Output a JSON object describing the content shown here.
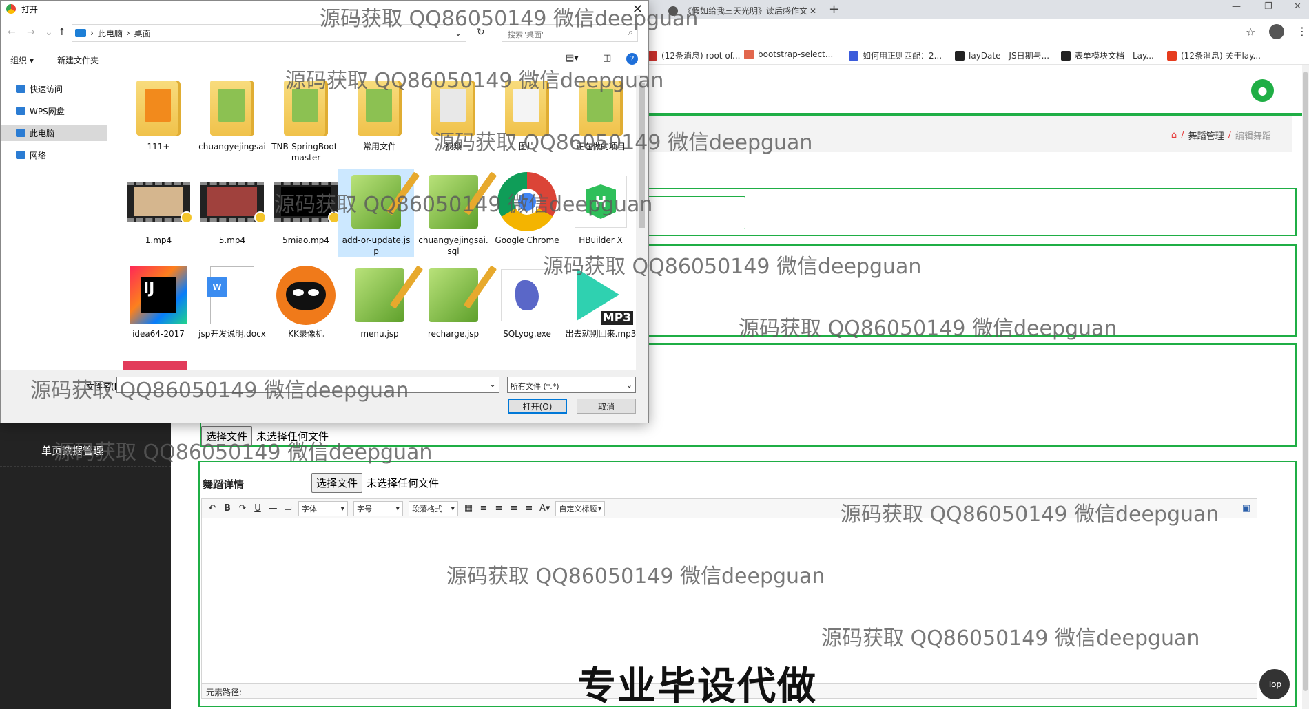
{
  "browser": {
    "tab_title": "《假如给我三天光明》读后感作文",
    "new_tab_symbol": "+",
    "bookmarks": [
      {
        "label": "(12条消息) root of...",
        "color": "#c9302c"
      },
      {
        "label": "bootstrap-select...",
        "color": "#e2664c"
      },
      {
        "label": "如何用正则匹配：2...",
        "color": "#3b5bdb"
      },
      {
        "label": "layDate - JS日期与...",
        "color": "#222222"
      },
      {
        "label": "表单模块文档 - Lay...",
        "color": "#222222"
      },
      {
        "label": "(12条消息) 关于lay...",
        "color": "#e63c1e"
      }
    ]
  },
  "app": {
    "breadcrumb": {
      "home_icon": "home-icon",
      "sep": "/",
      "module": "舞蹈管理",
      "current": "编辑舞蹈"
    },
    "sidebar": {
      "items": [
        {
          "label": "单页数据管理"
        }
      ]
    },
    "file_inputs": [
      {
        "button": "选择文件",
        "status": "未选择任何文件"
      },
      {
        "button": "选择文件",
        "status": "未选择任何文件"
      }
    ],
    "detail_label": "舞蹈详情",
    "editor": {
      "font_select": "字体",
      "size_select": "字号",
      "para_select": "段落格式",
      "title_select": "自定义标题",
      "status_path": "元素路径:"
    },
    "top_button": "Top",
    "accent": "#1fae45"
  },
  "dialog": {
    "title": "打开",
    "path": [
      "此电脑",
      "桌面"
    ],
    "search_placeholder": "搜索\"桌面\"",
    "organize": "组织 ▾",
    "new_folder": "新建文件夹",
    "nav": [
      {
        "label": "快速访问",
        "color": "#2b7cd3"
      },
      {
        "label": "WPS网盘",
        "color": "#2b7cd3"
      },
      {
        "label": "此电脑",
        "color": "#2b7cd3"
      },
      {
        "label": "网络",
        "color": "#2b7cd3"
      }
    ],
    "files_row1": [
      {
        "name": "111+",
        "kind": "folder"
      },
      {
        "name": "chuangyejingsai",
        "kind": "folder"
      },
      {
        "name": "TNB-SpringBoot-master",
        "kind": "folder"
      },
      {
        "name": "常用文件",
        "kind": "folder"
      },
      {
        "name": "视频",
        "kind": "folder"
      },
      {
        "name": "图片",
        "kind": "folder"
      },
      {
        "name": "正在做的项目",
        "kind": "folder"
      }
    ],
    "files_row2": [
      {
        "name": "1.mp4",
        "kind": "video"
      },
      {
        "name": "5.mp4",
        "kind": "video"
      },
      {
        "name": "5miao.mp4",
        "kind": "video"
      },
      {
        "name": "add-or-update.jsp",
        "kind": "notepad",
        "selected": true
      },
      {
        "name": "chuangyejingsai.sql",
        "kind": "notepad"
      },
      {
        "name": "Google Chrome",
        "kind": "chrome"
      },
      {
        "name": "HBuilder X",
        "kind": "hbuilder"
      }
    ],
    "files_row3": [
      {
        "name": "idea64-2017",
        "kind": "idea"
      },
      {
        "name": "jsp开发说明.docx",
        "kind": "docx"
      },
      {
        "name": "KK录像机",
        "kind": "kk"
      },
      {
        "name": "menu.jsp",
        "kind": "notepad"
      },
      {
        "name": "recharge.jsp",
        "kind": "notepad"
      },
      {
        "name": "SQLyog.exe",
        "kind": "sqlyog"
      },
      {
        "name": "出去就别回来.mp3",
        "kind": "mp3"
      }
    ],
    "filename_label": "文件名(N):",
    "filetype": "所有文件 (*.*)",
    "open_button": "打开(O)",
    "cancel_button": "取消"
  },
  "watermark": "源码获取 QQ86050149 微信deepguan",
  "banner": "专业毕设代做"
}
